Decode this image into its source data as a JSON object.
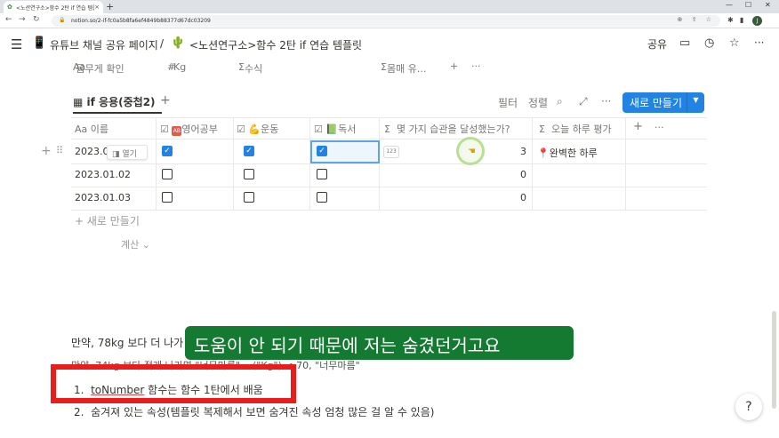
{
  "browser": {
    "tab_title": "<노션연구소>함수 2탄 if 연습 템플릿",
    "tab_close": "×",
    "new_tab": "+",
    "window_controls": [
      "—",
      "☐",
      "✕"
    ],
    "url": "notion.so/2-if-fc0a5b8fa6ef4849b88377d67dc03209",
    "profile_initial": "J"
  },
  "topbar": {
    "breadcrumb": [
      {
        "icon": "phone-icon",
        "label": "유튜브 채널 공유 페이지"
      },
      {
        "separator": "/"
      },
      {
        "icon": "cactus-icon",
        "label": "<노션연구소>함수 2탄 if 연습 템플릿"
      }
    ],
    "share_label": "공유"
  },
  "props_row": [
    {
      "prefix": "Aa",
      "label": "몸무게 확인"
    },
    {
      "prefix": "#",
      "label": "Kg"
    },
    {
      "prefix": "Σ",
      "label": "수식"
    },
    {
      "prefix": "Σ",
      "label": "몸매 유..."
    }
  ],
  "view": {
    "name": "if 응용(중첩2)",
    "filter_label": "필터",
    "sort_label": "정렬",
    "new_button": "새로 만들기"
  },
  "table": {
    "columns": [
      {
        "prefix": "Aa",
        "label": "이름"
      },
      {
        "prefix": "☑",
        "label": "영어공부"
      },
      {
        "prefix": "☑",
        "label": "운동"
      },
      {
        "prefix": "☑",
        "label": "독서"
      },
      {
        "prefix": "Σ",
        "label": "몇 가지 습관을 달성했는가?"
      },
      {
        "prefix": "Σ",
        "label": "오늘 하루 평가"
      }
    ],
    "rows": [
      {
        "name": "2023.01",
        "english": true,
        "exercise": true,
        "reading": true,
        "count": "3",
        "rating": "완벽한 하루"
      },
      {
        "name": "2023.01.02",
        "english": false,
        "exercise": false,
        "reading": false,
        "count": "0",
        "rating": ""
      },
      {
        "name": "2023.01.03",
        "english": false,
        "exercise": false,
        "reading": false,
        "count": "0",
        "rating": ""
      }
    ],
    "open_label": "열기",
    "formula_badge": "123",
    "new_row_label": "+ 새로 만들기",
    "calc_label": "계산 ⌄"
  },
  "content": {
    "line1": "만약, 78kg 보다 더 나가",
    "line2": "만약, 74kg 보다 적게 나가면 \"너무마름\" ...(\"Kg\") < 70, \"너무마름\"",
    "list": [
      {
        "num": "1.",
        "text_under": "toNumber",
        "text_rest": " 함수는 함수 1탄에서 배움"
      },
      {
        "num": "2.",
        "text": "숨겨져 있는 속성(템플릿 복제해서 보면 숨겨진 속성 엄청 많은 걸 알 수 있음)"
      }
    ]
  },
  "subtitle": "도움이 안 되기 때문에 저는 숨겼던거고요",
  "help_label": "?"
}
